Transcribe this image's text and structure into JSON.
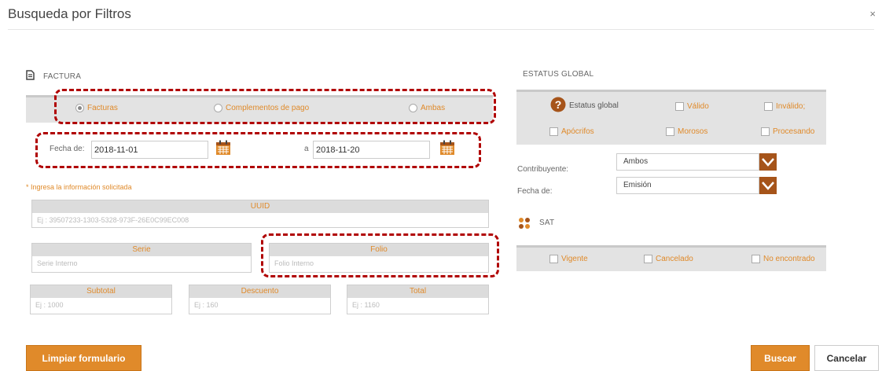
{
  "dialog": {
    "title": "Busqueda por Filtros",
    "close_label": "×"
  },
  "factura": {
    "label": "FACTURA",
    "radios": [
      {
        "label": "Facturas",
        "selected": true
      },
      {
        "label": "Complementos de pago",
        "selected": false
      },
      {
        "label": "Ambas",
        "selected": false
      }
    ],
    "fecha_de_label": "Fecha de:",
    "fecha_de_value": "2018-11-01",
    "a_label": "a",
    "fecha_a_value": "2018-11-20",
    "required_note": "* Ingresa la información solicitada",
    "uuid": {
      "label": "UUID",
      "placeholder": "Ej : 39507233-1303-5328-973F-26E0C99EC008"
    },
    "serie": {
      "label": "Serie",
      "placeholder": "Serie Interno"
    },
    "folio": {
      "label": "Folio",
      "placeholder": "Folio Interno"
    },
    "subtotal": {
      "label": "Subtotal",
      "placeholder": "Ej : 1000"
    },
    "descuento": {
      "label": "Descuento",
      "placeholder": "Ej : 160"
    },
    "total": {
      "label": "Total",
      "placeholder": "Ej : 1160"
    }
  },
  "estatus": {
    "label": "ESTATUS GLOBAL",
    "estatus_global_label": "Estatus global",
    "checks_row1": [
      "Válido",
      "Inválido;"
    ],
    "checks_row2": [
      "Apócrifos",
      "Morosos",
      "Procesando"
    ],
    "contribuyente_label": "Contribuyente:",
    "contribuyente_value": "Ambos",
    "fecha_label": "Fecha de:",
    "fecha_value": "Emisión",
    "sat_label": "SAT",
    "sat_checks": [
      "Vigente",
      "Cancelado",
      "No encontrado"
    ]
  },
  "buttons": {
    "limpiar": "Limpiar formulario",
    "buscar": "Buscar",
    "cancelar": "Cancelar"
  },
  "colors": {
    "accent": "#e08a2a",
    "annotation": "#b00000",
    "arrow": "#a6541a"
  }
}
